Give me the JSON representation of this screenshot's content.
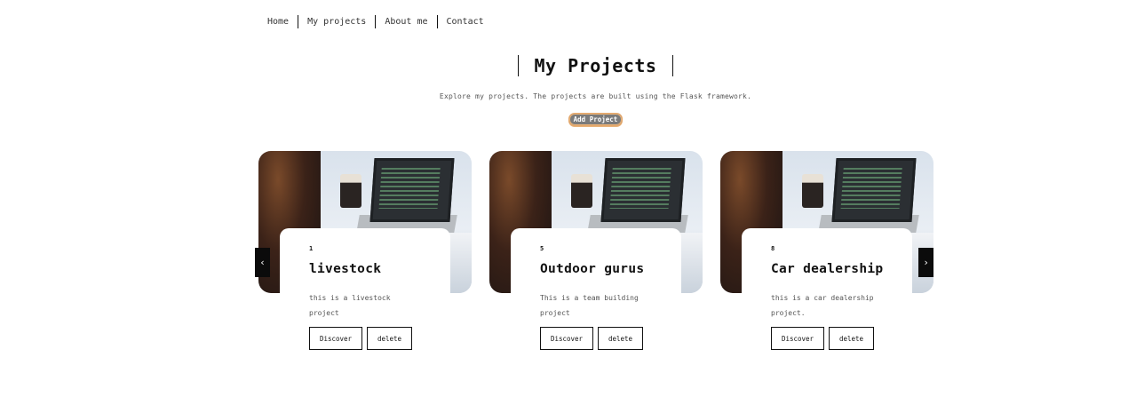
{
  "nav": {
    "items": [
      "Home",
      "My projects",
      "About me",
      "Contact"
    ]
  },
  "hero": {
    "title": "My Projects",
    "subtitle": "Explore my projects. The projects are built using the Flask framework.",
    "add_button": "Add Project"
  },
  "projects": [
    {
      "id": "1",
      "title": "livestock",
      "description": "this is a livestock project",
      "discover_label": "Discover",
      "delete_label": "delete"
    },
    {
      "id": "5",
      "title": "Outdoor gurus",
      "description": "This is a team building project",
      "discover_label": "Discover",
      "delete_label": "delete"
    },
    {
      "id": "8",
      "title": "Car dealership",
      "description": "this is a car dealership project.",
      "discover_label": "Discover",
      "delete_label": "delete"
    }
  ],
  "carousel": {
    "prev_icon": "chevron-left-icon",
    "next_icon": "chevron-right-icon",
    "prev_glyph": "‹",
    "next_glyph": "›"
  },
  "colors": {
    "add_button_bg": "#7a7a7a",
    "add_button_border": "#e2a56a"
  }
}
